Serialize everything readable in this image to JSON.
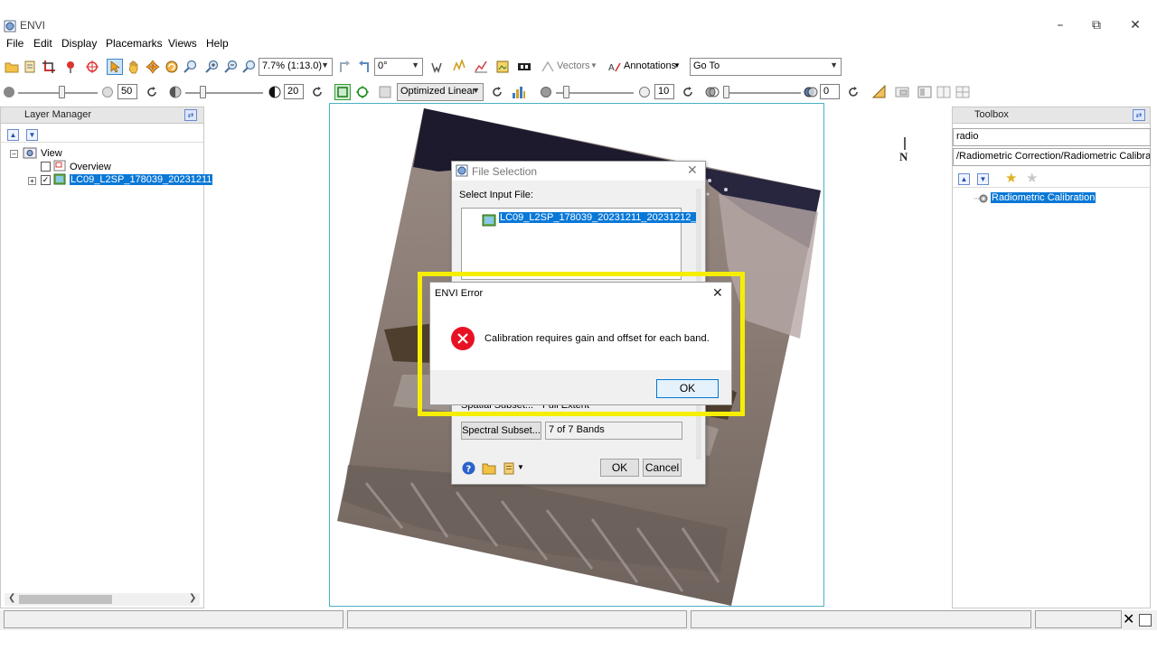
{
  "app": {
    "title": "ENVI"
  },
  "window_controls": {
    "minimize": "–",
    "maximize": "⧉",
    "close": "✕"
  },
  "menu": [
    "File",
    "Edit",
    "Display",
    "Placemarks",
    "Views",
    "Help"
  ],
  "toolbar1": {
    "zoom_value": "7.7% (1:13.0)",
    "rotation_value": "0°",
    "vectors_label": "Vectors",
    "annotations_label": "Annotations",
    "goto_value": "Go To"
  },
  "toolbar2": {
    "brightness_value": "50",
    "contrast_value": "20",
    "stretch_value": "Optimized Linear",
    "sharpen_value": "10",
    "transparency_value": "0",
    "brightness_level": 0.55,
    "contrast_level": 0.2,
    "sharpen_level": 0.1,
    "transparency_level": 0.0
  },
  "layer_manager": {
    "title": "Layer Manager",
    "view_label": "View",
    "overview_label": "Overview",
    "layer_label": "LC09_L2SP_178039_20231211"
  },
  "toolbox": {
    "title": "Toolbox",
    "search_value": "radio",
    "path_value": "/Radiometric Correction/Radiometric Calibration",
    "item_label": "Radiometric Calibration"
  },
  "north_label": "N",
  "file_selection": {
    "title": "File Selection",
    "select_label": "Select Input File:",
    "file_item": "LC09_L2SP_178039_20231211_20231212_",
    "spatial_label": "Spatial Subset...",
    "spatial_value": "Full Extent",
    "spectral_button": "Spectral Subset...",
    "spectral_value": "7 of 7 Bands",
    "ok_button": "OK",
    "cancel_button": "Cancel"
  },
  "error_dialog": {
    "title": "ENVI Error",
    "message": "Calibration requires gain and offset for each band.",
    "ok_button": "OK"
  },
  "colors": {
    "highlight": "#f5ee00",
    "selection": "#0a78d7",
    "error_icon": "#e81123",
    "viewer_border": "#4ab1c4"
  }
}
